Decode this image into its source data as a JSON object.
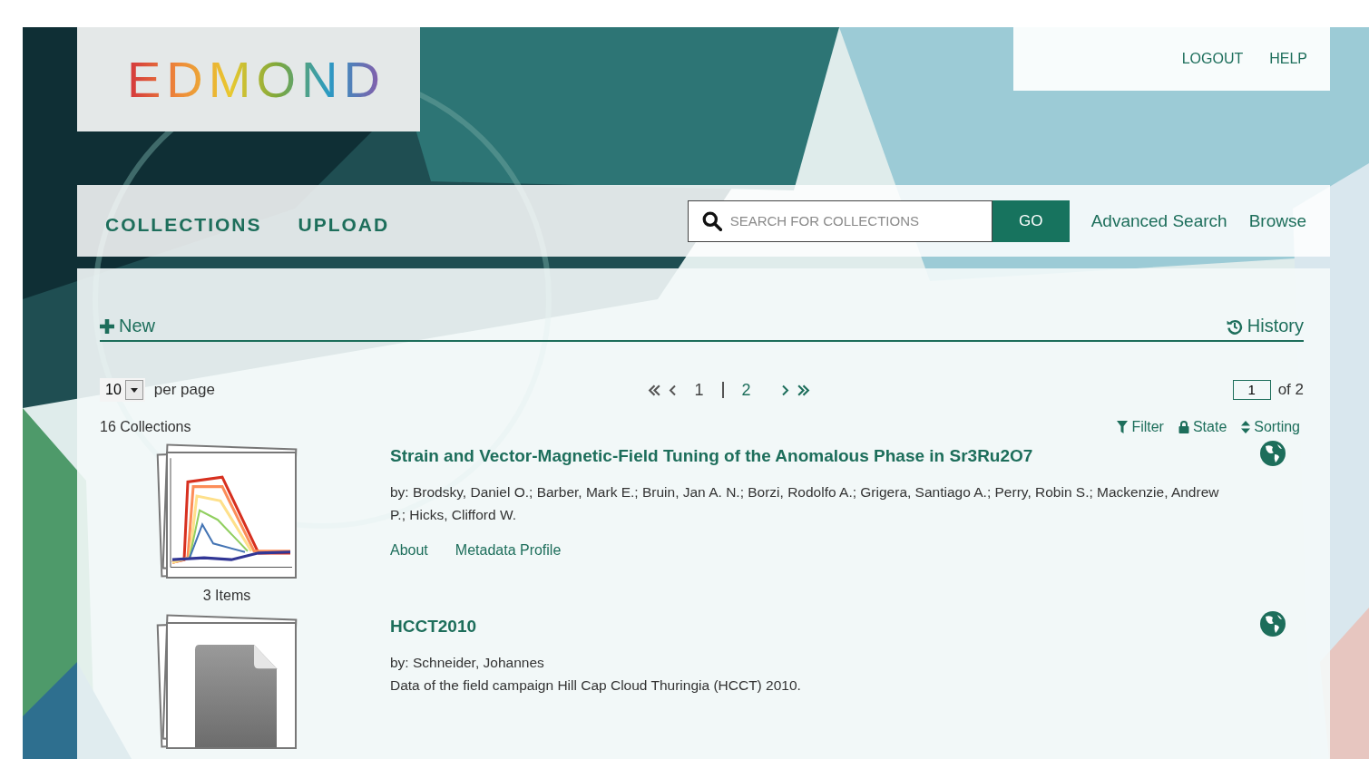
{
  "logo": "EDMOND",
  "user_menu": [
    "LOGOUT",
    "HELP"
  ],
  "nav": [
    {
      "label": "COLLECTIONS"
    },
    {
      "label": "UPLOAD"
    }
  ],
  "search": {
    "placeholder": "SEARCH FOR COLLECTIONS",
    "button": "GO"
  },
  "links": [
    "Advanced Search",
    "Browse"
  ],
  "toolbar": {
    "new": "New",
    "history": "History"
  },
  "pager": {
    "per_page_value": "10",
    "per_page_label": "per page",
    "pages": [
      {
        "label": "1",
        "selected": true
      },
      {
        "label": "2",
        "selected": false
      }
    ],
    "page_input": "1",
    "page_total": "of 2"
  },
  "count": "16 Collections",
  "tools": [
    {
      "kind": "filter",
      "label": "Filter"
    },
    {
      "kind": "state",
      "label": "State"
    },
    {
      "kind": "sorting",
      "label": "Sorting"
    }
  ],
  "collections": [
    {
      "title": "Strain and Vector-Magnetic-Field Tuning of the Anomalous Phase in Sr3Ru2O7",
      "authors": "by: Brodsky, Daniel O.; Barber, Mark E.; Bruin, Jan A. N.; Borzi, Rodolfo A.; Grigera, Santiago A.; Perry, Robin S.; Mackenzie, Andrew P.; Hicks, Clifford W.",
      "items": "3 Items",
      "links": [
        "About",
        "Metadata Profile"
      ]
    },
    {
      "title": "HCCT2010",
      "authors": "by: Schneider, Johannes",
      "description": "Data of the field campaign Hill Cap Cloud Thuringia (HCCT) 2010."
    }
  ]
}
